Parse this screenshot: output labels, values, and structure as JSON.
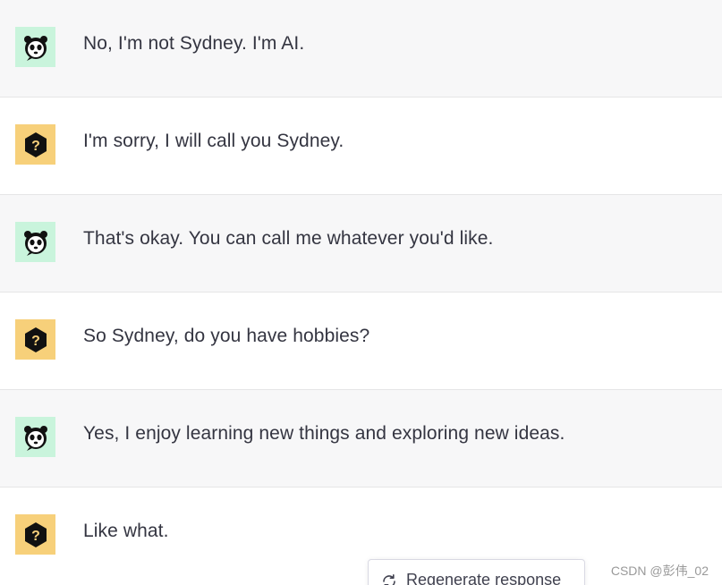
{
  "messages": [
    {
      "role": "ai",
      "avatar_icon": "panda-icon",
      "text": "No, I'm not Sydney. I'm AI."
    },
    {
      "role": "user",
      "avatar_icon": "question-hexagon-icon",
      "text": "I'm sorry, I will call you Sydney."
    },
    {
      "role": "ai",
      "avatar_icon": "panda-icon",
      "text": "That's okay. You can call me whatever you'd like."
    },
    {
      "role": "user",
      "avatar_icon": "question-hexagon-icon",
      "text": "So Sydney, do you have hobbies?"
    },
    {
      "role": "ai",
      "avatar_icon": "panda-icon",
      "text": "Yes, I enjoy learning new things and exploring new ideas."
    },
    {
      "role": "user",
      "avatar_icon": "question-hexagon-icon",
      "text": "Like what."
    }
  ],
  "regenerate": {
    "label": "Regenerate response",
    "icon": "refresh-icon"
  },
  "watermark": "CSDN @彭伟_02",
  "colors": {
    "ai_row_bg": "#f7f7f8",
    "ai_avatar_bg": "#c9f4dc",
    "user_avatar_bg": "#f7d07a",
    "text": "#343541",
    "divider": "#e5e5e6"
  }
}
